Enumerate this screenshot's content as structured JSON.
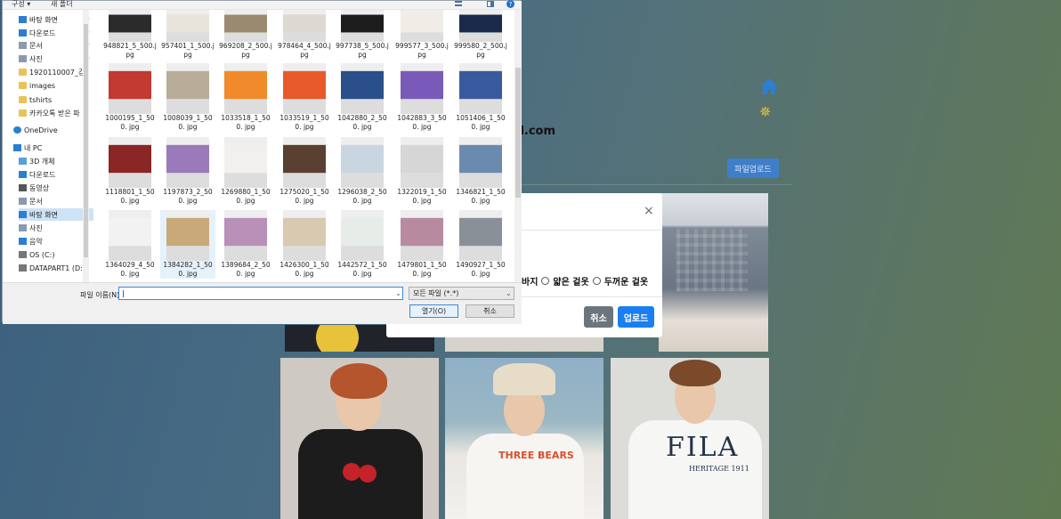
{
  "background_page": {
    "email_fragment": "il.com",
    "upload_page_button": "파일업로드",
    "fila_print": "FILA",
    "fila_sub": "HERITAGE 1911",
    "bears_print": "THREE BEARS"
  },
  "modal": {
    "close": "×",
    "radio_options": [
      "바지",
      "얇은 겉옷",
      "두꺼운 겉옷"
    ],
    "cancel": "취소",
    "upload": "업로드"
  },
  "file_dialog": {
    "toolbar": {
      "organize": "구성 ▾",
      "new_folder": "새 폴더",
      "help": "?"
    },
    "nav_items": [
      {
        "label": "바탕 화면",
        "icon": "desktop-icon",
        "pinned": true
      },
      {
        "label": "다운로드",
        "icon": "download-icon",
        "pinned": true
      },
      {
        "label": "문서",
        "icon": "document-icon",
        "pinned": true
      },
      {
        "label": "사진",
        "icon": "picture-icon",
        "pinned": true
      },
      {
        "label": "1920110007_김",
        "icon": "folder-icon"
      },
      {
        "label": "images",
        "icon": "folder-icon"
      },
      {
        "label": "tshirts",
        "icon": "folder-icon"
      },
      {
        "label": "카카오톡 받은 파",
        "icon": "folder-icon"
      },
      {
        "label": "OneDrive",
        "icon": "cloud-icon"
      },
      {
        "label": "내 PC",
        "icon": "pc-icon"
      },
      {
        "label": "3D 개체",
        "icon": "cube-icon"
      },
      {
        "label": "다운로드",
        "icon": "download-icon"
      },
      {
        "label": "동영상",
        "icon": "video-icon"
      },
      {
        "label": "문서",
        "icon": "document-icon"
      },
      {
        "label": "바탕 화면",
        "icon": "desktop-icon",
        "selected": true
      },
      {
        "label": "사진",
        "icon": "picture-icon"
      },
      {
        "label": "음악",
        "icon": "music-icon"
      },
      {
        "label": "OS (C:)",
        "icon": "drive-icon"
      },
      {
        "label": "DATAPART1 (D:",
        "icon": "drive-icon"
      }
    ],
    "files": [
      [
        "948821_5_500.j pg",
        "957401_1_500.j pg",
        "969208_2_500.j pg",
        "978464_4_500.j pg",
        "997738_5_500.j pg",
        "999577_3_500.j pg",
        "999580_2_500.j pg"
      ],
      [
        "1000195_1_500. jpg",
        "1008039_1_500. jpg",
        "1033518_1_500. jpg",
        "1033519_1_500. jpg",
        "1042880_2_500. jpg",
        "1042883_3_500. jpg",
        "1051406_1_500. jpg"
      ],
      [
        "1118801_1_500. jpg",
        "1197873_2_500. jpg",
        "1269880_1_500. jpg",
        "1275020_1_500. jpg",
        "1296038_2_500. jpg",
        "1322019_1_500. jpg",
        "1346821_1_500. jpg"
      ],
      [
        "1364029_4_500. jpg",
        "1384282_1_500. jpg",
        "1389684_2_500. jpg",
        "1426300_1_500. jpg",
        "1442572_1_500. jpg",
        "1479801_1_500. jpg",
        "1490927_1_500. jpg"
      ]
    ],
    "filename_label": "파일 이름(N):",
    "filename_value": "|",
    "filetype_value": "모든 파일 (*.*)",
    "open_button": "열기(O)",
    "cancel_button": "취소"
  }
}
